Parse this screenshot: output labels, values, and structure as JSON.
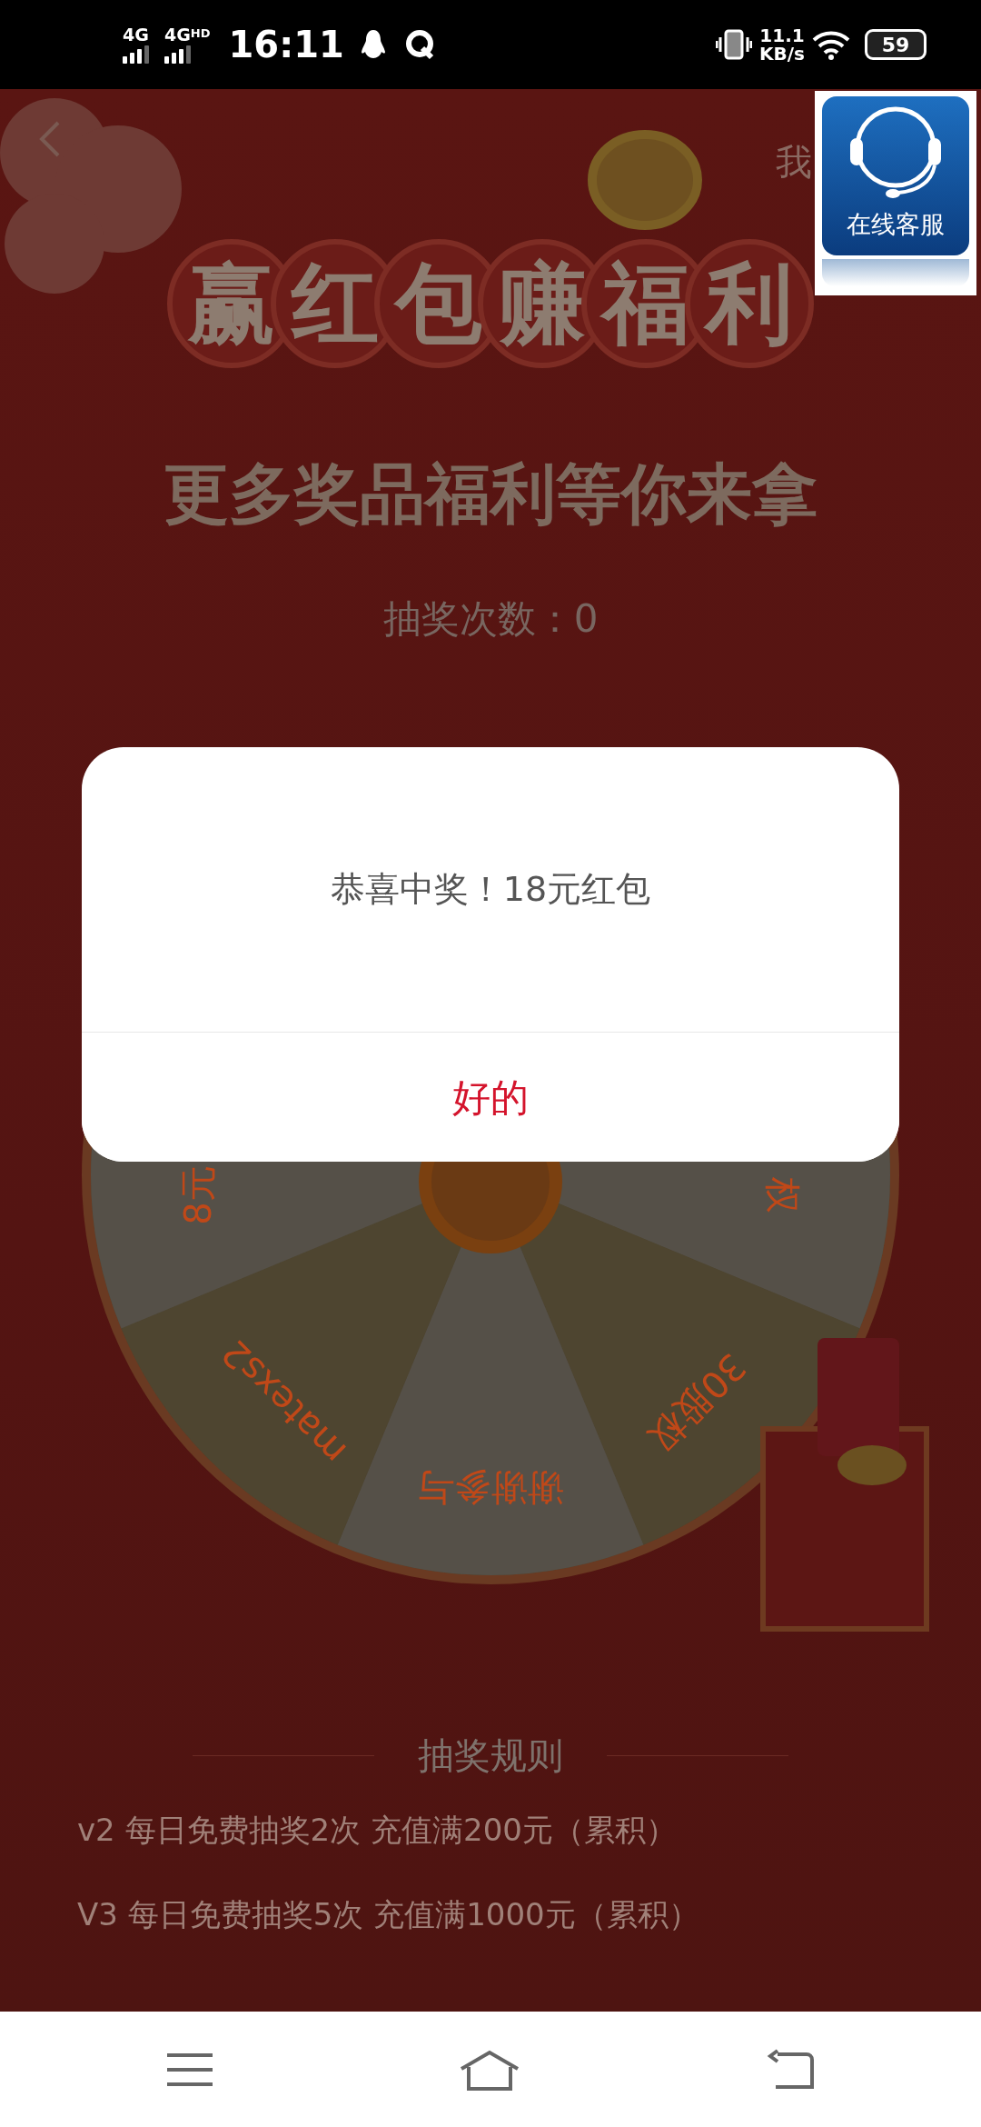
{
  "status_bar": {
    "network_1": "4G",
    "network_2": "4G$^{HD}$",
    "time": "16:11",
    "speed": "11.1",
    "speed_unit": "KB/s",
    "battery": "59"
  },
  "header": {
    "right_text": "我"
  },
  "service_button": {
    "label": "在线客服"
  },
  "banner": {
    "title_chars": [
      "赢",
      "红",
      "包",
      "赚",
      "福",
      "利"
    ],
    "subtitle": "更多奖品福利等你来拿"
  },
  "draw_count": "抽奖次数：0",
  "wheel": {
    "sectors": [
      {
        "kind": "light",
        "label": "权"
      },
      {
        "kind": "gold",
        "label": "30股权"
      },
      {
        "kind": "light",
        "label": "谢谢参与"
      },
      {
        "kind": "gold",
        "label": "matexs2"
      },
      {
        "kind": "light",
        "label": "8元"
      }
    ]
  },
  "dialog": {
    "message": "恭喜中奖！18元红包",
    "button": "好的"
  },
  "rules": {
    "title": "抽奖规则",
    "lines": [
      "v2 每日免费抽奖2次   充值满200元（累积）",
      "V3 每日免费抽奖5次   充值满1000元（累积）"
    ]
  }
}
